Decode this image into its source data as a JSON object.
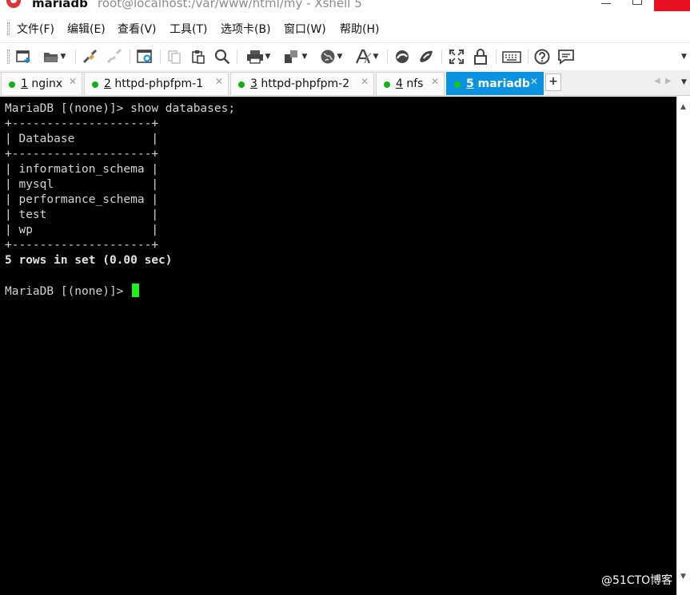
{
  "title": {
    "session_name": "mariadb",
    "window_caption": "root@localhost:/var/www/html/my - Xshell 5"
  },
  "menu": [
    {
      "label": "文件(F)"
    },
    {
      "label": "编辑(E)"
    },
    {
      "label": "查看(V)"
    },
    {
      "label": "工具(T)"
    },
    {
      "label": "选项卡(B)"
    },
    {
      "label": "窗口(W)"
    },
    {
      "label": "帮助(H)"
    }
  ],
  "toolbar": {
    "new_session": "new-session-icon",
    "open": "folder-open-icon",
    "connect": "connect-icon",
    "disconnect": "disconnect-icon",
    "properties": "session-properties-icon",
    "copy": "copy-icon",
    "paste": "paste-icon",
    "find": "search-icon",
    "print": "print-icon",
    "transfer": "transfer-icon",
    "globe": "globe-icon",
    "font": "font-icon",
    "xftp": "xftp-icon",
    "xshell_green": "xmanager-icon",
    "fullscreen": "fullscreen-icon",
    "lock": "lock-icon",
    "keyboard": "keyboard-icon",
    "help": "help-icon",
    "chat": "chat-icon"
  },
  "tabs": [
    {
      "num": "1",
      "label": "nginx",
      "active": false
    },
    {
      "num": "2",
      "label": "httpd-phpfpm-1",
      "active": false
    },
    {
      "num": "3",
      "label": "httpd-phpfpm-2",
      "active": false
    },
    {
      "num": "4",
      "label": "nfs",
      "active": false
    },
    {
      "num": "5",
      "label": "mariadb",
      "active": true
    }
  ],
  "tab_add_label": "+",
  "terminal": {
    "lines": [
      {
        "text": "MariaDB [(none)]> show databases;",
        "bold": false
      },
      {
        "text": "+--------------------+",
        "bold": false
      },
      {
        "text": "| Database           |",
        "bold": false
      },
      {
        "text": "+--------------------+",
        "bold": false
      },
      {
        "text": "| information_schema |",
        "bold": false
      },
      {
        "text": "| mysql              |",
        "bold": false
      },
      {
        "text": "| performance_schema |",
        "bold": false
      },
      {
        "text": "| test               |",
        "bold": false
      },
      {
        "text": "| wp                 |",
        "bold": false
      },
      {
        "text": "+--------------------+",
        "bold": false
      },
      {
        "text": "5 rows in set (0.00 sec)",
        "bold": true
      },
      {
        "text": "",
        "bold": false
      },
      {
        "text": "MariaDB [(none)]> ",
        "bold": false
      }
    ],
    "cursor_color": "#1cf21c"
  },
  "watermark": "@51CTO博客",
  "colors": {
    "active_tab": "#0a93e0",
    "tab_dot": "#12b012",
    "close_button": "#e81123"
  }
}
